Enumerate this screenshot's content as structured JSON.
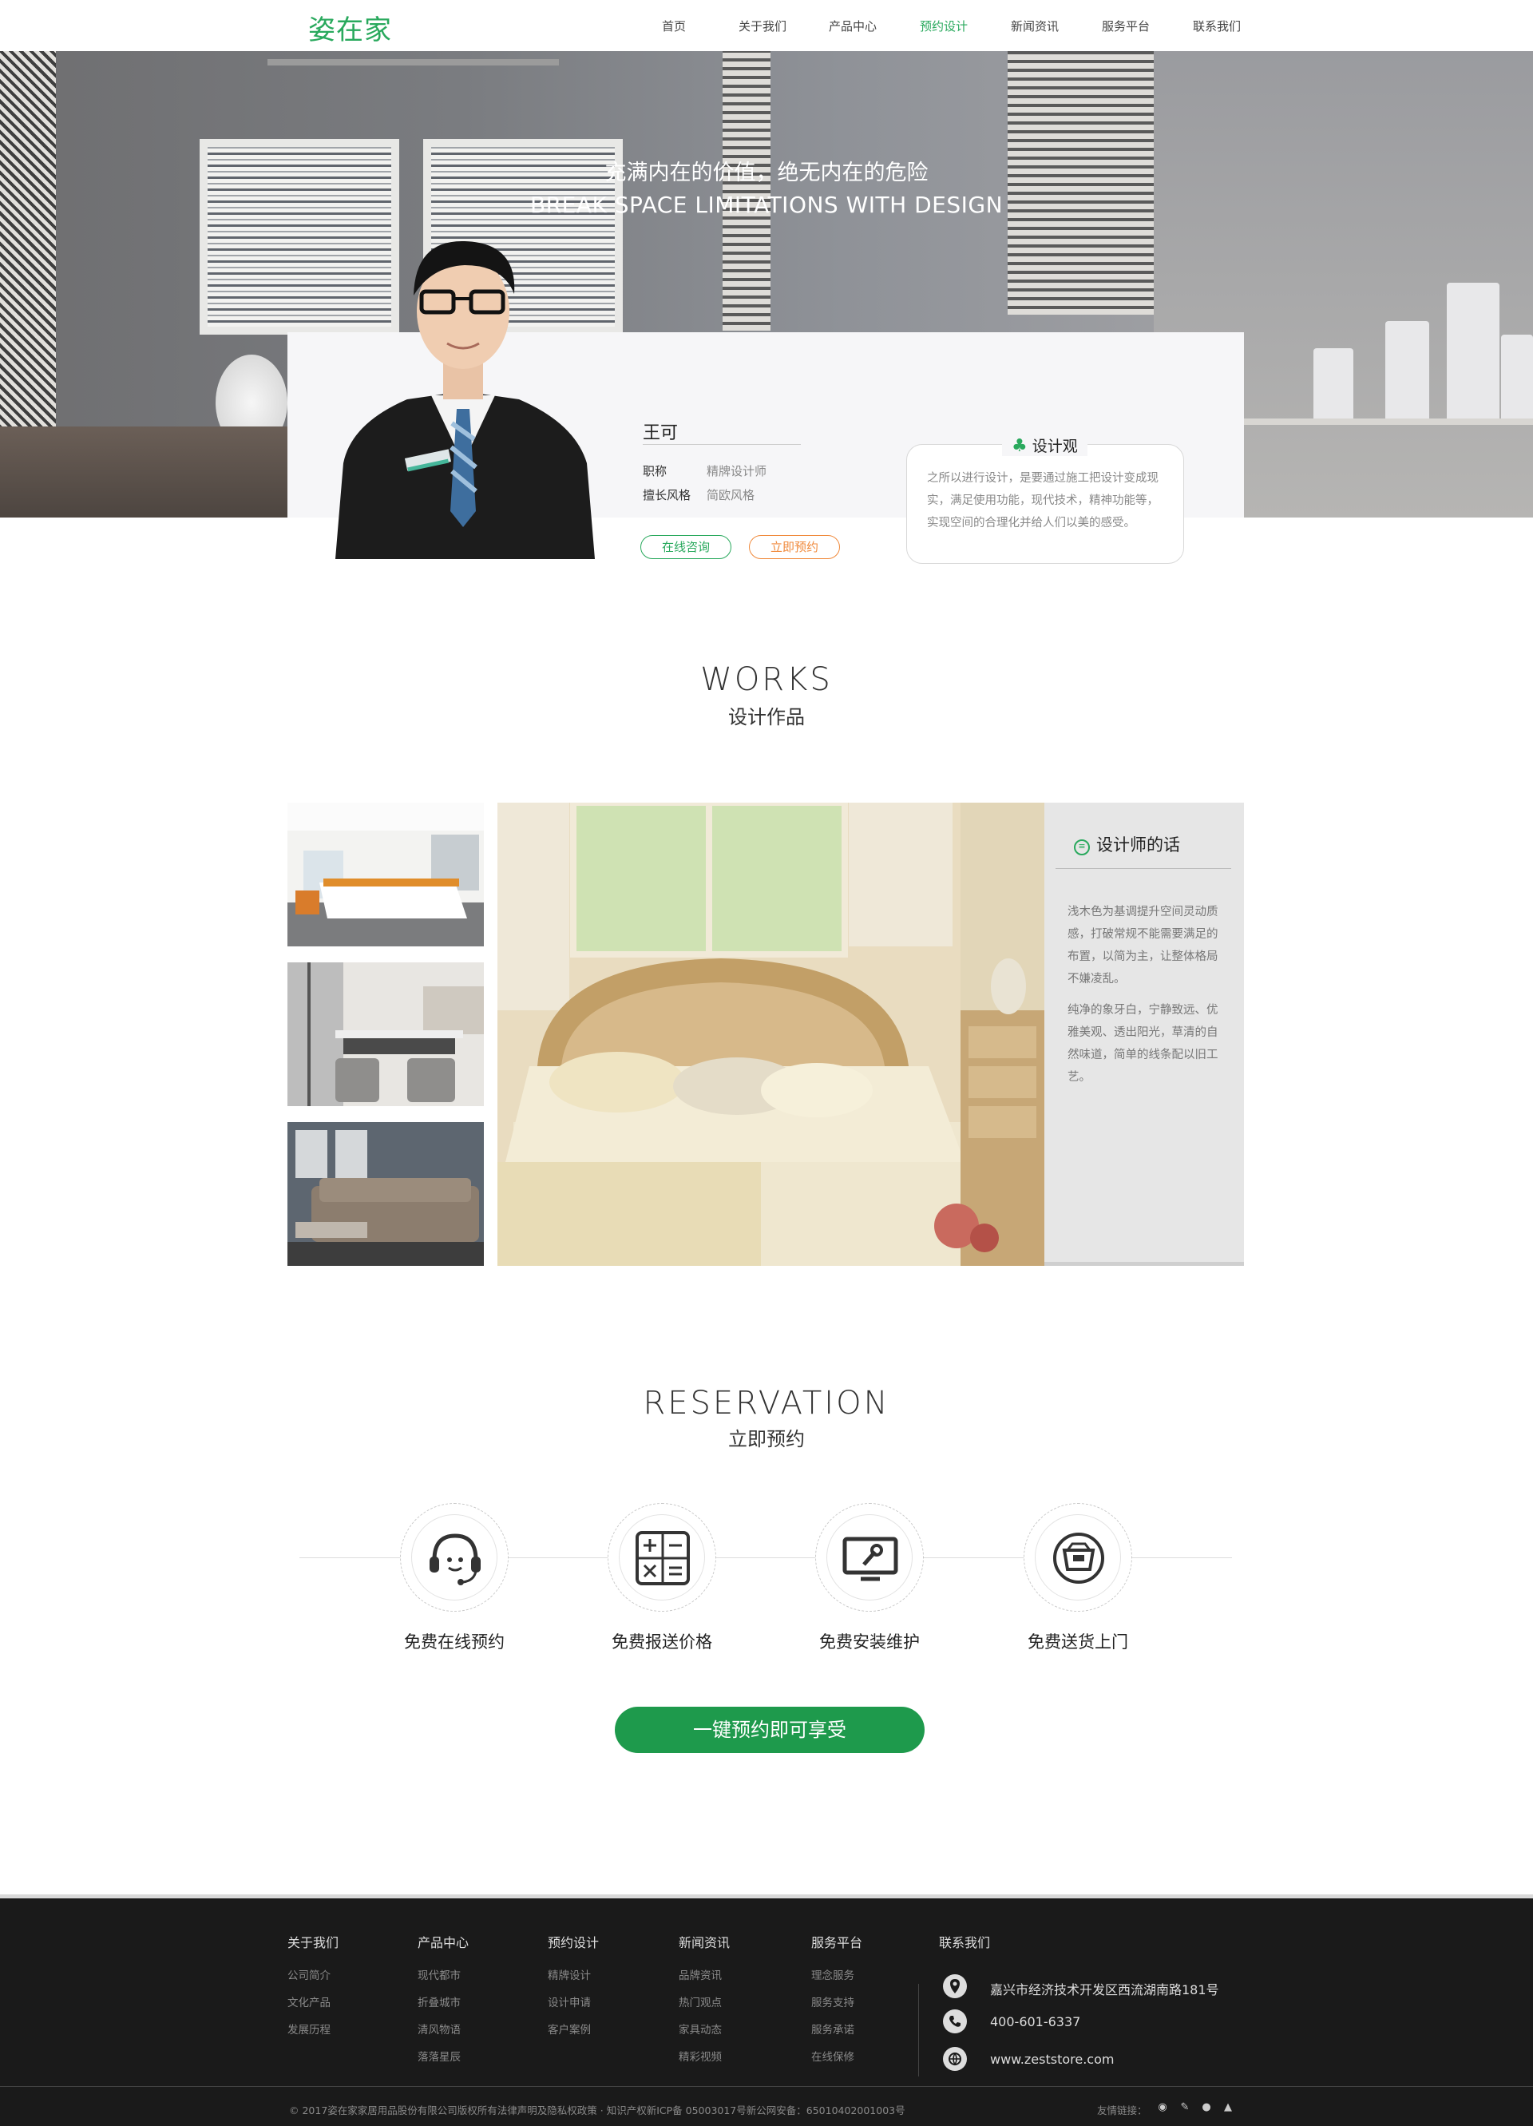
{
  "brand": {
    "logo_text": "姿在家",
    "accent": "#29a95d",
    "cta_color": "#1e9a4c"
  },
  "nav": {
    "items": [
      "首页",
      "关于我们",
      "产品中心",
      "预约设计",
      "新闻资讯",
      "服务平台",
      "联系我们"
    ],
    "active_index": 3
  },
  "hero": {
    "title_cn": "充满内在的价值，绝无内在的危险",
    "title_en": "BREAK SPACE LIMITATIONS WITH DESIGN"
  },
  "designer": {
    "name": "王可",
    "title_label": "职称",
    "title_value": "精牌设计师",
    "style_label": "擅长风格",
    "style_value": "简欧风格",
    "consult_button": "在线咨询",
    "book_button": "立即预约",
    "philosophy_heading": "设计观",
    "philosophy_text": "之所以进行设计，是要通过施工把设计变成现实，满足使用功能，现代技术，精神功能等，实现空间的合理化并给人们以美的感受。"
  },
  "works": {
    "heading_en": "WORKS",
    "heading_cn": "设计作品",
    "quote_heading": "设计师的话",
    "quote_p1": "浅木色为基调提升空间灵动质感，打破常规不能需要满足的布置，以简为主，让整体格局不嫌凌乱。",
    "quote_p2": "纯净的象牙白，宁静致远、优雅美观、透出阳光，草清的自然味道，简单的线条配以旧工艺。"
  },
  "reservation": {
    "heading_en": "RESERVATION",
    "heading_cn": "立即预约",
    "services": [
      {
        "label": "免费在线预约",
        "icon": "headset-icon"
      },
      {
        "label": "免费报送价格",
        "icon": "calculator-icon"
      },
      {
        "label": "免费安装维护",
        "icon": "repair-monitor-icon"
      },
      {
        "label": "免费送货上门",
        "icon": "delivery-box-icon"
      }
    ],
    "cta": "一键预约即可享受"
  },
  "footer": {
    "columns": [
      {
        "heading": "关于我们",
        "links": [
          "公司简介",
          "文化产品",
          "发展历程"
        ]
      },
      {
        "heading": "产品中心",
        "links": [
          "现代都市",
          "折叠城市",
          "清风物语",
          "落落星辰"
        ]
      },
      {
        "heading": "预约设计",
        "links": [
          "精牌设计",
          "设计申请",
          "客户案例"
        ]
      },
      {
        "heading": "新闻资讯",
        "links": [
          "品牌资讯",
          "热门观点",
          "家具动态",
          "精彩视频"
        ]
      },
      {
        "heading": "服务平台",
        "links": [
          "理念服务",
          "服务支持",
          "服务承诺",
          "在线保修"
        ]
      }
    ],
    "contact_heading": "联系我们",
    "address": "嘉兴市经济技术开发区西流湖南路181号",
    "phone": "400-601-6337",
    "website": "www.zeststore.com",
    "copyright": "© 2017姿在家家居用品股份有限公司版权所有法律声明及隐私权政策 · 知识产权新ICP备 05003017号新公网安备：65010402001003号",
    "friend_links_label": "友情链接："
  }
}
